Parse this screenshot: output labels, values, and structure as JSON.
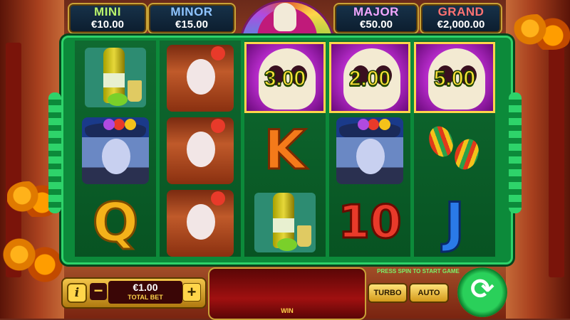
{
  "jackpots": {
    "mini": {
      "name": "MINI",
      "value": "€10.00"
    },
    "minor": {
      "name": "MINOR",
      "value": "€15.00"
    },
    "major": {
      "name": "MAJOR",
      "value": "€50.00"
    },
    "grand": {
      "name": "GRAND",
      "value": "€2,000.00"
    }
  },
  "reels": [
    [
      "tequila",
      "day-of-dead-man",
      "Q"
    ],
    [
      "catrina-woman",
      "catrina-woman",
      "catrina-woman"
    ],
    [
      "bonus-skull",
      "K",
      "tequila"
    ],
    [
      "bonus-skull",
      "day-of-dead-man",
      "10"
    ],
    [
      "bonus-skull",
      "maracas",
      "J"
    ]
  ],
  "symbols": {
    "q": "Q",
    "k": "K",
    "ten": "10",
    "j": "J"
  },
  "bonus_values": {
    "reel3": "3.00",
    "reel4": "2.00",
    "reel5": "5.00"
  },
  "controls": {
    "info_label": "i",
    "minus_label": "−",
    "plus_label": "+",
    "total_bet_value": "€1.00",
    "total_bet_label": "TOTAL BET",
    "win_label": "WIN",
    "hint": "PRESS SPIN TO START GAME",
    "turbo_label": "TURBO",
    "auto_label": "AUTO",
    "spin_icon": "⟳"
  },
  "colors": {
    "frame": "#0c8a3a",
    "bonus": "#b42ac8",
    "gold": "#ffd54a"
  }
}
